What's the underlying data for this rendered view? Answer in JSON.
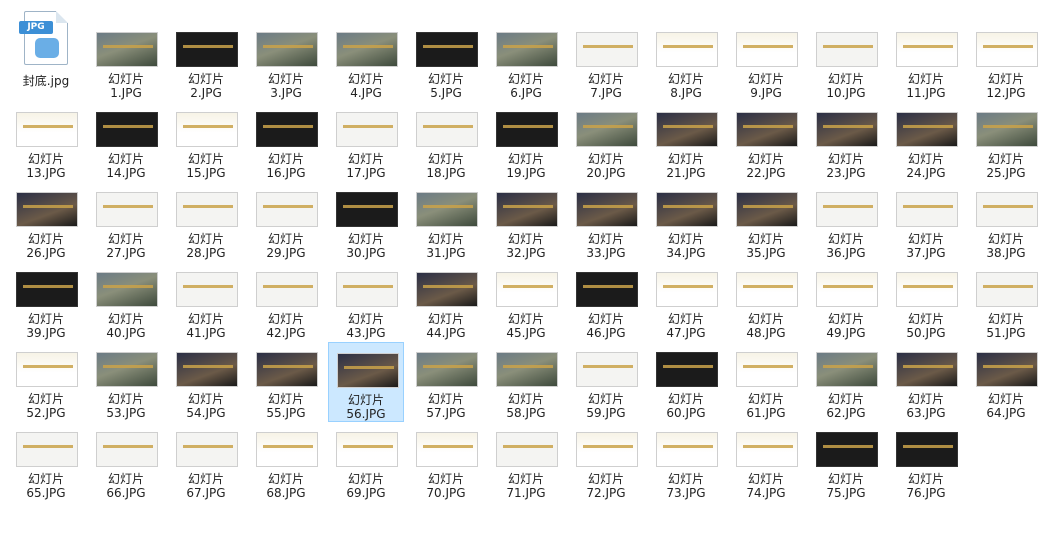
{
  "cover": {
    "name": "封底.jpg",
    "icon_badge": "JPG",
    "icon": "jpg-file-icon"
  },
  "thumbnail_label_prefix": "幻灯片",
  "selected": "56.JPG",
  "files": [
    {
      "line1": "幻灯片",
      "line2": "1.JPG",
      "style": "img"
    },
    {
      "line1": "幻灯片",
      "line2": "2.JPG",
      "style": "dark"
    },
    {
      "line1": "幻灯片",
      "line2": "3.JPG",
      "style": "img"
    },
    {
      "line1": "幻灯片",
      "line2": "4.JPG",
      "style": "img"
    },
    {
      "line1": "幻灯片",
      "line2": "5.JPG",
      "style": "dark"
    },
    {
      "line1": "幻灯片",
      "line2": "6.JPG",
      "style": "img"
    },
    {
      "line1": "幻灯片",
      "line2": "7.JPG",
      "style": "light"
    },
    {
      "line1": "幻灯片",
      "line2": "8.JPG",
      "style": "gold"
    },
    {
      "line1": "幻灯片",
      "line2": "9.JPG",
      "style": "gold"
    },
    {
      "line1": "幻灯片",
      "line2": "10.JPG",
      "style": "light"
    },
    {
      "line1": "幻灯片",
      "line2": "11.JPG",
      "style": "gold"
    },
    {
      "line1": "幻灯片",
      "line2": "12.JPG",
      "style": "gold"
    },
    {
      "line1": "幻灯片",
      "line2": "13.JPG",
      "style": "gold"
    },
    {
      "line1": "幻灯片",
      "line2": "14.JPG",
      "style": "dark"
    },
    {
      "line1": "幻灯片",
      "line2": "15.JPG",
      "style": "gold"
    },
    {
      "line1": "幻灯片",
      "line2": "16.JPG",
      "style": "dark"
    },
    {
      "line1": "幻灯片",
      "line2": "17.JPG",
      "style": "light"
    },
    {
      "line1": "幻灯片",
      "line2": "18.JPG",
      "style": "light"
    },
    {
      "line1": "幻灯片",
      "line2": "19.JPG",
      "style": "dark"
    },
    {
      "line1": "幻灯片",
      "line2": "20.JPG",
      "style": "img"
    },
    {
      "line1": "幻灯片",
      "line2": "21.JPG",
      "style": "night"
    },
    {
      "line1": "幻灯片",
      "line2": "22.JPG",
      "style": "night"
    },
    {
      "line1": "幻灯片",
      "line2": "23.JPG",
      "style": "night"
    },
    {
      "line1": "幻灯片",
      "line2": "24.JPG",
      "style": "night"
    },
    {
      "line1": "幻灯片",
      "line2": "25.JPG",
      "style": "img"
    },
    {
      "line1": "幻灯片",
      "line2": "26.JPG",
      "style": "night"
    },
    {
      "line1": "幻灯片",
      "line2": "27.JPG",
      "style": "light"
    },
    {
      "line1": "幻灯片",
      "line2": "28.JPG",
      "style": "light"
    },
    {
      "line1": "幻灯片",
      "line2": "29.JPG",
      "style": "light"
    },
    {
      "line1": "幻灯片",
      "line2": "30.JPG",
      "style": "dark"
    },
    {
      "line1": "幻灯片",
      "line2": "31.JPG",
      "style": "img"
    },
    {
      "line1": "幻灯片",
      "line2": "32.JPG",
      "style": "night"
    },
    {
      "line1": "幻灯片",
      "line2": "33.JPG",
      "style": "night"
    },
    {
      "line1": "幻灯片",
      "line2": "34.JPG",
      "style": "night"
    },
    {
      "line1": "幻灯片",
      "line2": "35.JPG",
      "style": "night"
    },
    {
      "line1": "幻灯片",
      "line2": "36.JPG",
      "style": "light"
    },
    {
      "line1": "幻灯片",
      "line2": "37.JPG",
      "style": "light"
    },
    {
      "line1": "幻灯片",
      "line2": "38.JPG",
      "style": "light"
    },
    {
      "line1": "幻灯片",
      "line2": "39.JPG",
      "style": "dark"
    },
    {
      "line1": "幻灯片",
      "line2": "40.JPG",
      "style": "img"
    },
    {
      "line1": "幻灯片",
      "line2": "41.JPG",
      "style": "light"
    },
    {
      "line1": "幻灯片",
      "line2": "42.JPG",
      "style": "light"
    },
    {
      "line1": "幻灯片",
      "line2": "43.JPG",
      "style": "light"
    },
    {
      "line1": "幻灯片",
      "line2": "44.JPG",
      "style": "night"
    },
    {
      "line1": "幻灯片",
      "line2": "45.JPG",
      "style": "gold"
    },
    {
      "line1": "幻灯片",
      "line2": "46.JPG",
      "style": "dark"
    },
    {
      "line1": "幻灯片",
      "line2": "47.JPG",
      "style": "gold"
    },
    {
      "line1": "幻灯片",
      "line2": "48.JPG",
      "style": "gold"
    },
    {
      "line1": "幻灯片",
      "line2": "49.JPG",
      "style": "gold"
    },
    {
      "line1": "幻灯片",
      "line2": "50.JPG",
      "style": "gold"
    },
    {
      "line1": "幻灯片",
      "line2": "51.JPG",
      "style": "light"
    },
    {
      "line1": "幻灯片",
      "line2": "52.JPG",
      "style": "gold"
    },
    {
      "line1": "幻灯片",
      "line2": "53.JPG",
      "style": "img"
    },
    {
      "line1": "幻灯片",
      "line2": "54.JPG",
      "style": "night"
    },
    {
      "line1": "幻灯片",
      "line2": "55.JPG",
      "style": "night"
    },
    {
      "line1": "幻灯片",
      "line2": "56.JPG",
      "style": "night"
    },
    {
      "line1": "幻灯片",
      "line2": "57.JPG",
      "style": "img"
    },
    {
      "line1": "幻灯片",
      "line2": "58.JPG",
      "style": "img"
    },
    {
      "line1": "幻灯片",
      "line2": "59.JPG",
      "style": "light"
    },
    {
      "line1": "幻灯片",
      "line2": "60.JPG",
      "style": "dark"
    },
    {
      "line1": "幻灯片",
      "line2": "61.JPG",
      "style": "gold"
    },
    {
      "line1": "幻灯片",
      "line2": "62.JPG",
      "style": "img"
    },
    {
      "line1": "幻灯片",
      "line2": "63.JPG",
      "style": "night"
    },
    {
      "line1": "幻灯片",
      "line2": "64.JPG",
      "style": "night"
    },
    {
      "line1": "幻灯片",
      "line2": "65.JPG",
      "style": "light"
    },
    {
      "line1": "幻灯片",
      "line2": "66.JPG",
      "style": "light"
    },
    {
      "line1": "幻灯片",
      "line2": "67.JPG",
      "style": "light"
    },
    {
      "line1": "幻灯片",
      "line2": "68.JPG",
      "style": "gold"
    },
    {
      "line1": "幻灯片",
      "line2": "69.JPG",
      "style": "gold"
    },
    {
      "line1": "幻灯片",
      "line2": "70.JPG",
      "style": "gold"
    },
    {
      "line1": "幻灯片",
      "line2": "71.JPG",
      "style": "light"
    },
    {
      "line1": "幻灯片",
      "line2": "72.JPG",
      "style": "gold"
    },
    {
      "line1": "幻灯片",
      "line2": "73.JPG",
      "style": "gold"
    },
    {
      "line1": "幻灯片",
      "line2": "74.JPG",
      "style": "gold"
    },
    {
      "line1": "幻灯片",
      "line2": "75.JPG",
      "style": "dark"
    },
    {
      "line1": "幻灯片",
      "line2": "76.JPG",
      "style": "dark"
    }
  ]
}
